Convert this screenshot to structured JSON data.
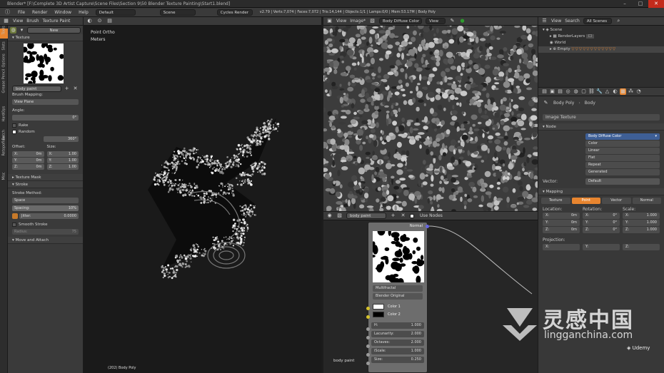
{
  "titlebar": {
    "title": "Blender* [F:\\Complete 3D Artist Capture\\Scene Files\\Section 9\\50 Blender Texture Painting\\Start1.blend]"
  },
  "infobar": {
    "menus": [
      "File",
      "Render",
      "Window",
      "Help"
    ],
    "layout": "Default",
    "scene": "Scene",
    "engine": "Cycles Render",
    "stats": "v2.79 | Verts:7,074 | Faces:7,072 | Tris:14,144 | Objects:1/1 | Lamps:0/0 | Mem:53.17M | Body Poly"
  },
  "toolheader": {
    "menus": [
      "View",
      "Brush"
    ],
    "mode": "Texture Paint"
  },
  "tabs": [
    "Tools",
    "Slots",
    "Options",
    "Grease Pencil",
    "HardOps",
    "Batch",
    "Retopoflow",
    "Misc"
  ],
  "toolpanel": {
    "new_label": "New",
    "texture_section": "Texture",
    "texture_name": "body paint",
    "brush_mapping_label": "Brush Mapping:",
    "mapping_value": "View Plane",
    "angle_label": "Angle:",
    "angle_value": "0°",
    "rake_label": "Rake",
    "random_label": "Random",
    "random_value": "360°",
    "offset_label": "Offset:",
    "size_label": "Size:",
    "offset": [
      {
        "axis": "X:",
        "value": "0m"
      },
      {
        "axis": "Y:",
        "value": "0m"
      },
      {
        "axis": "Z:",
        "value": "0m"
      }
    ],
    "size": [
      {
        "axis": "X:",
        "value": "1.00"
      },
      {
        "axis": "Y:",
        "value": "1.00"
      },
      {
        "axis": "Z:",
        "value": "1.00"
      }
    ],
    "texture_mask": "Texture Mask",
    "stroke": "Stroke",
    "stroke_method_label": "Stroke Method:",
    "stroke_method": "Space",
    "spacing_label": "Spacing:",
    "spacing_value": "10%",
    "jitter_label": "Jitter:",
    "jitter_value": "0.0000",
    "smooth_stroke": "Smooth Stroke",
    "radius_label": "Radius:",
    "radius_value": "75",
    "move_attach": "Move and Attach"
  },
  "viewport": {
    "label_top": "Point Ortho",
    "label_units": "Meters",
    "object_label": "(202) Body Poly"
  },
  "imageeditor": {
    "menus": [
      "View",
      "Image*"
    ],
    "image_name": "Body Diffuse Color",
    "view_label": "View"
  },
  "nodeeditor": {
    "tree_name": "body paint",
    "use_nodes": "Use Nodes",
    "frame_label": "body paint",
    "node": {
      "output": "Normal",
      "type": "Multifractal",
      "basis": "Blender Original",
      "color1": "Color 1",
      "color2": "Color 2",
      "params": [
        {
          "name": "H:",
          "value": "1.000"
        },
        {
          "name": "Lacunarity:",
          "value": "2.000"
        },
        {
          "name": "Octaves:",
          "value": "2.000"
        },
        {
          "name": "iScale:",
          "value": "1.000"
        },
        {
          "name": "Size:",
          "value": "0.250"
        }
      ]
    }
  },
  "outliner": {
    "menus": [
      "View",
      "Search"
    ],
    "filter": "All Scenes",
    "items": [
      "Scene",
      "RenderLayers",
      "World",
      "Empty"
    ]
  },
  "properties": {
    "breadcrumb": [
      "Body Poly",
      "Body"
    ],
    "image_texture": "Image Texture",
    "node_section": "Node",
    "node_name": "Body Diffuse Color",
    "color_options": [
      "Color",
      "Linear",
      "Flat",
      "Repeat",
      "Generated"
    ],
    "vector_label": "Vector:",
    "vector_value": "Default",
    "mapping_section": "Mapping",
    "mapping_tabs": [
      "Texture",
      "Point",
      "Vector",
      "Normal"
    ],
    "location_label": "Location:",
    "rotation_label": "Rotation:",
    "scale_label": "Scale:",
    "location": [
      "0m",
      "0m",
      "0m"
    ],
    "rotation": [
      "0°",
      "0°",
      "0°"
    ],
    "scale": [
      "1.000",
      "1.000",
      "1.000"
    ],
    "axes": [
      "X:",
      "Y:",
      "Z:"
    ],
    "projection_label": "Projection:"
  },
  "watermark": {
    "cn": "灵感中国",
    "url": "lingganchina.com",
    "brand": "Udemy"
  },
  "colors": {
    "accent": "#e8852f",
    "socket_yellow": "#d6c32a",
    "socket_grey": "#9a9a9a",
    "socket_blue": "#6767e0"
  }
}
